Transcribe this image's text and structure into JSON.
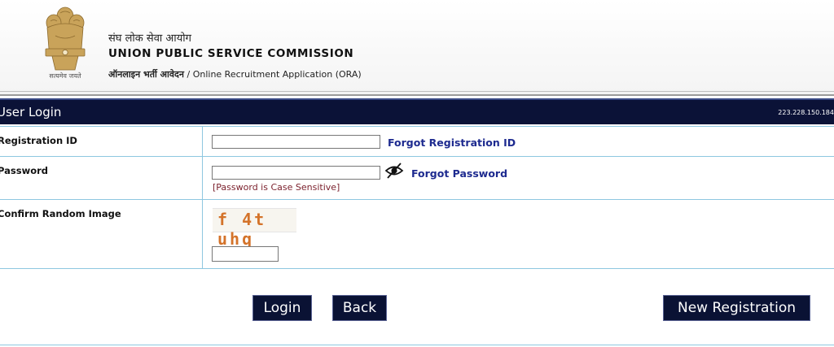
{
  "header": {
    "org_hindi": "संघ लोक सेवा आयोग",
    "org_english": "UNION PUBLIC SERVICE COMMISSION",
    "app_hindi": "ऑनलाइन भर्ती आवेदन",
    "app_sep": " / ",
    "app_english": "Online Recruitment Application (ORA)",
    "emblem_motto": "सत्यमेव जयते"
  },
  "titlebar": {
    "title": "User Login",
    "ip": "223.228.150.184"
  },
  "form": {
    "registration_label": "Registration ID",
    "registration_value": "",
    "forgot_registration": "Forgot Registration ID",
    "password_label": "Password",
    "password_value": "",
    "forgot_password": "Forgot Password",
    "password_hint": "[Password is Case Sensitive]",
    "captcha_label": "Confirm Random Image",
    "captcha_text": "f 4t uhq",
    "captcha_value": ""
  },
  "buttons": {
    "login": "Login",
    "back": "Back",
    "new_registration": "New Registration"
  },
  "icons": {
    "emblem": "national-emblem-icon",
    "password_toggle": "eye-icon"
  },
  "colors": {
    "titlebar_bg": "#0b1237",
    "link": "#1d2a8f",
    "hint": "#7a1f2b",
    "grid_line": "#8ec7e0",
    "captcha_text": "#d4732a"
  }
}
